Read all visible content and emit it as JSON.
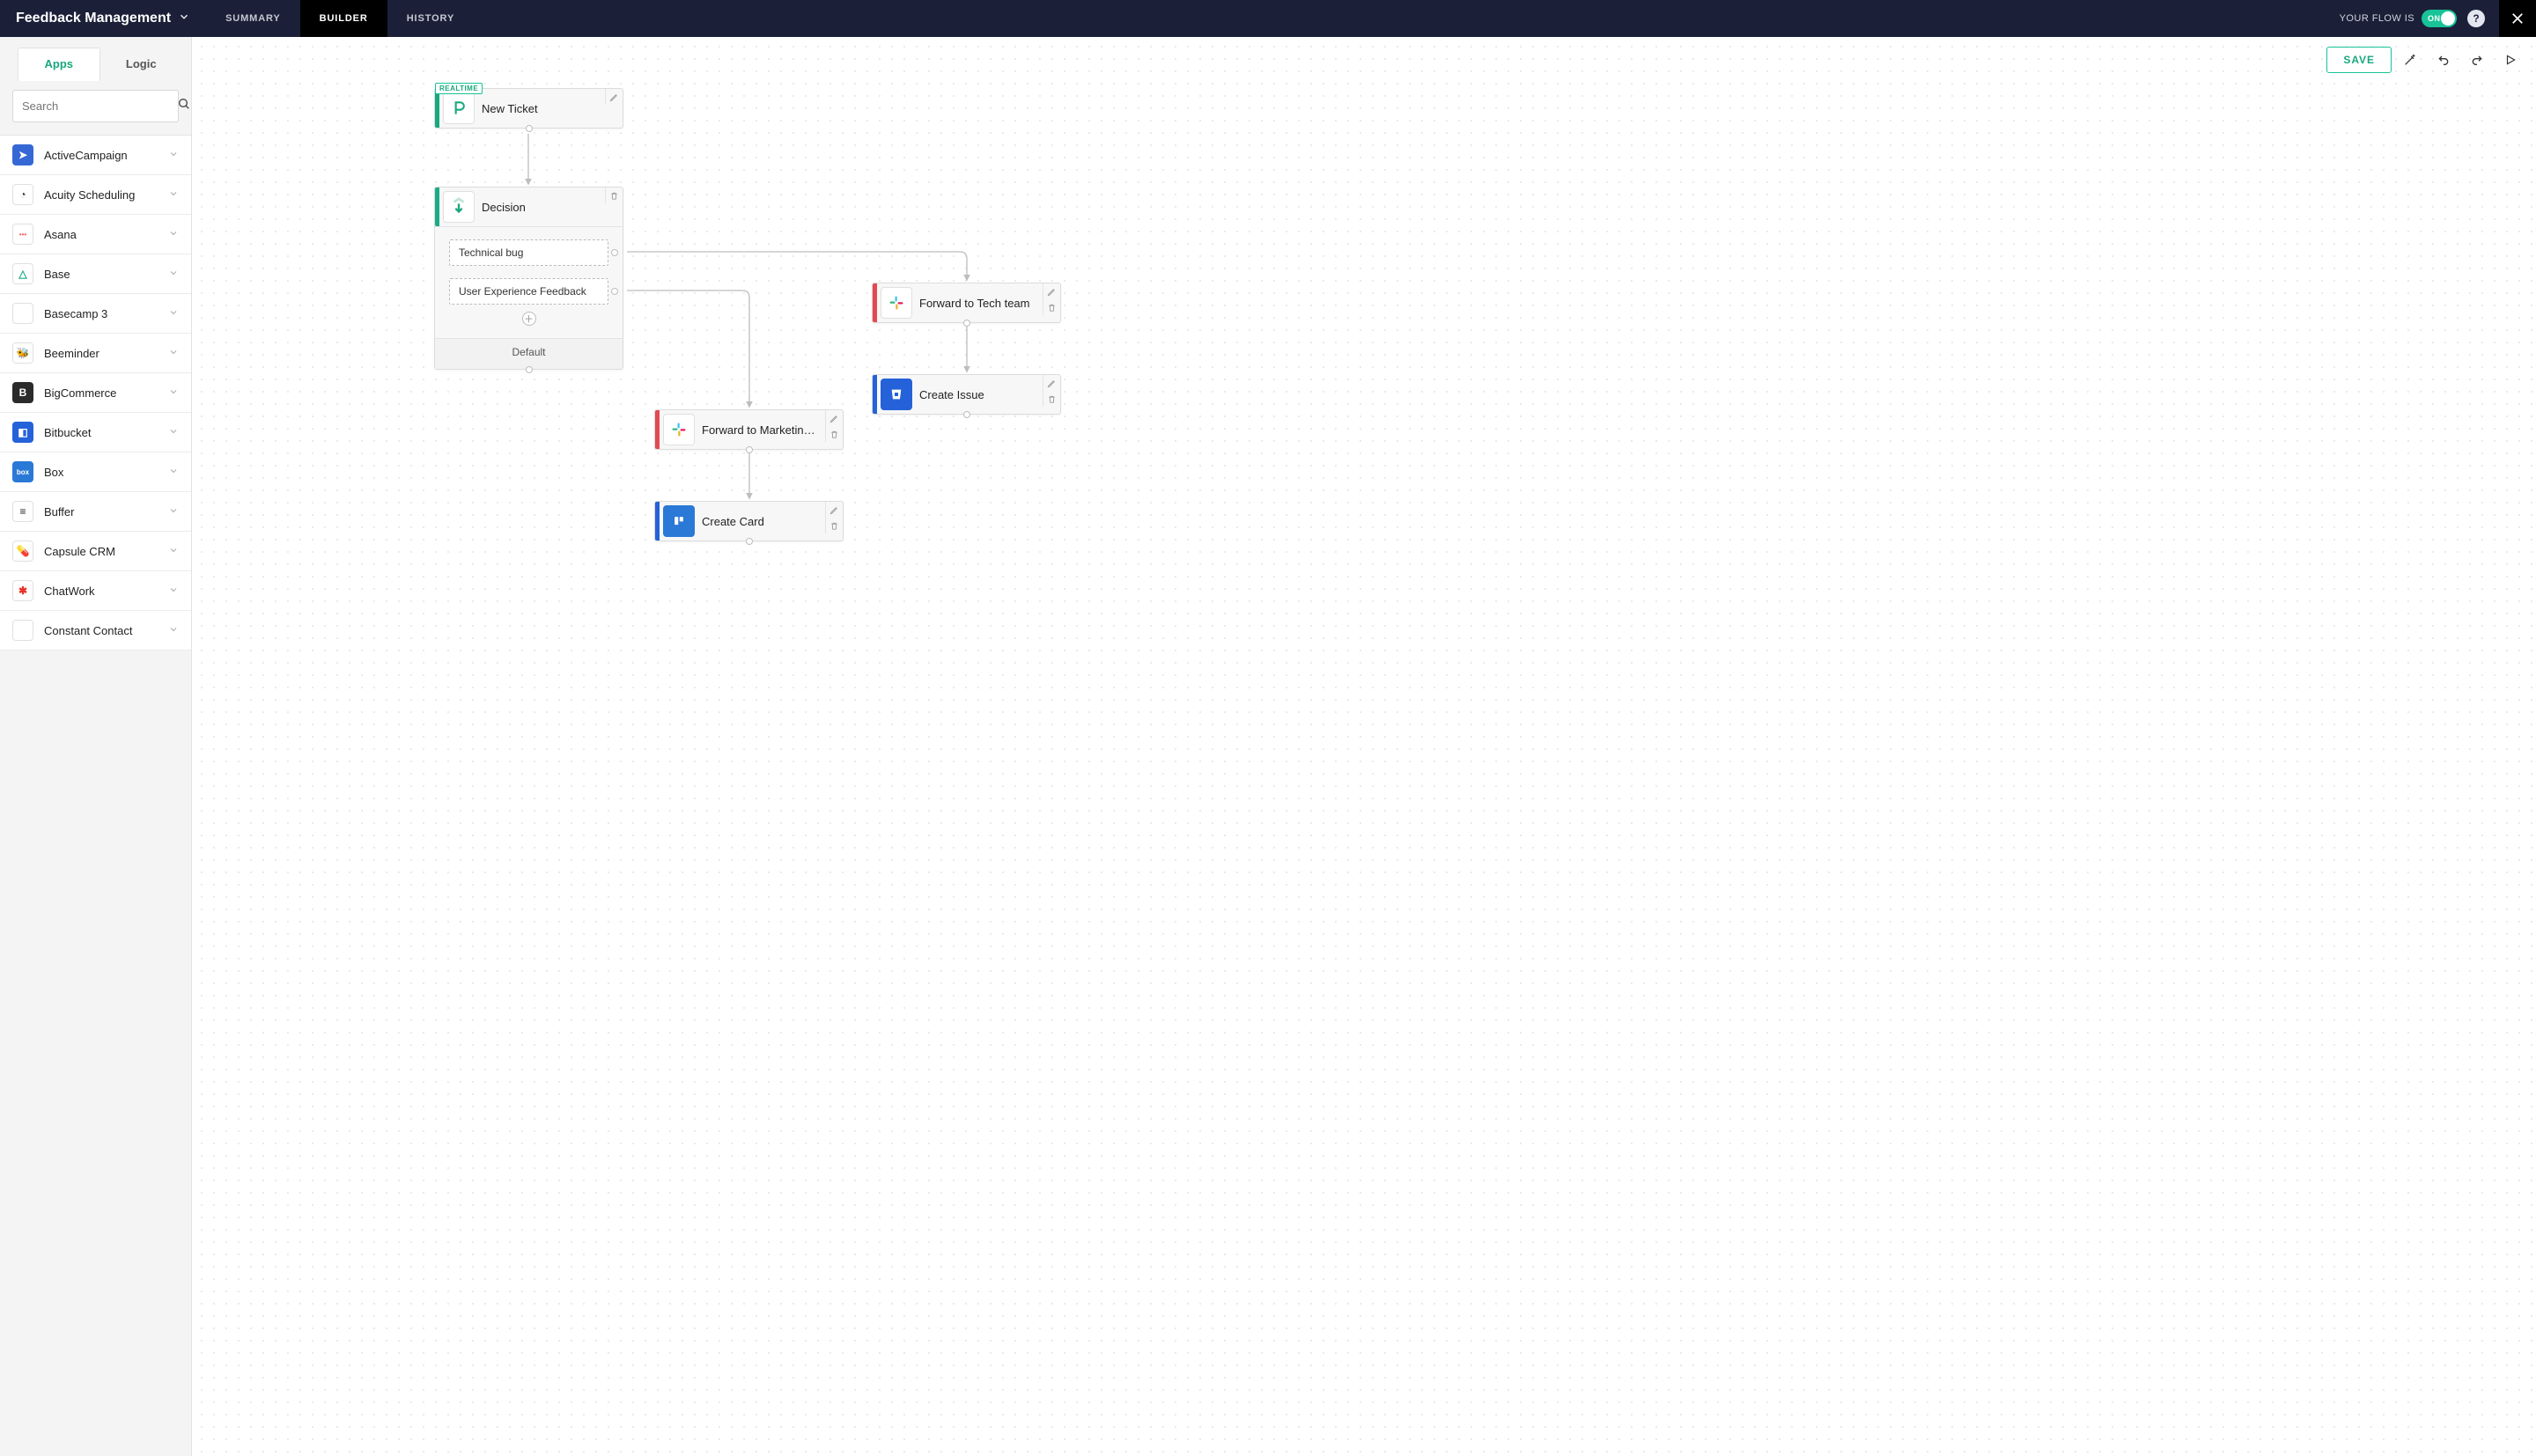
{
  "header": {
    "title": "Feedback Management",
    "tabs": [
      "SUMMARY",
      "BUILDER",
      "HISTORY"
    ],
    "active_tab": "BUILDER",
    "flow_status_label": "YOUR FLOW IS",
    "toggle_label": "ON",
    "help_label": "?"
  },
  "canvas_toolbar": {
    "save_label": "SAVE"
  },
  "sidebar": {
    "tabs": {
      "apps": "Apps",
      "logic": "Logic",
      "active": "Apps"
    },
    "search_placeholder": "Search",
    "apps": [
      {
        "name": "ActiveCampaign",
        "icon": "activecampaign",
        "glyph": "➤"
      },
      {
        "name": "Acuity Scheduling",
        "icon": "acuity",
        "glyph": "◔"
      },
      {
        "name": "Asana",
        "icon": "asana",
        "glyph": "•••"
      },
      {
        "name": "Base",
        "icon": "base",
        "glyph": "△"
      },
      {
        "name": "Basecamp 3",
        "icon": "basecamp",
        "glyph": "⛰"
      },
      {
        "name": "Beeminder",
        "icon": "beeminder",
        "glyph": "🐝"
      },
      {
        "name": "BigCommerce",
        "icon": "bigcommerce",
        "glyph": "B"
      },
      {
        "name": "Bitbucket",
        "icon": "bitbucket",
        "glyph": "◧"
      },
      {
        "name": "Box",
        "icon": "box",
        "glyph": "box"
      },
      {
        "name": "Buffer",
        "icon": "buffer",
        "glyph": "≡"
      },
      {
        "name": "Capsule CRM",
        "icon": "capsule",
        "glyph": "💊"
      },
      {
        "name": "ChatWork",
        "icon": "chatwork",
        "glyph": "✱"
      },
      {
        "name": "Constant Contact",
        "icon": "constant",
        "glyph": "✉"
      }
    ]
  },
  "nodes": {
    "trigger": {
      "title": "New Ticket",
      "badge": "REALTIME",
      "bar": "green"
    },
    "decision": {
      "title": "Decision",
      "bar": "teal",
      "branches": [
        "Technical bug",
        "User Experience Feedback"
      ],
      "default_label": "Default"
    },
    "fwd_tech": {
      "title": "Forward to Tech team",
      "bar": "red"
    },
    "create_iss": {
      "title": "Create Issue",
      "bar": "blue"
    },
    "fwd_mkt": {
      "title": "Forward to Marketing t...",
      "bar": "red"
    },
    "create_card": {
      "title": "Create Card",
      "bar": "blue"
    }
  }
}
